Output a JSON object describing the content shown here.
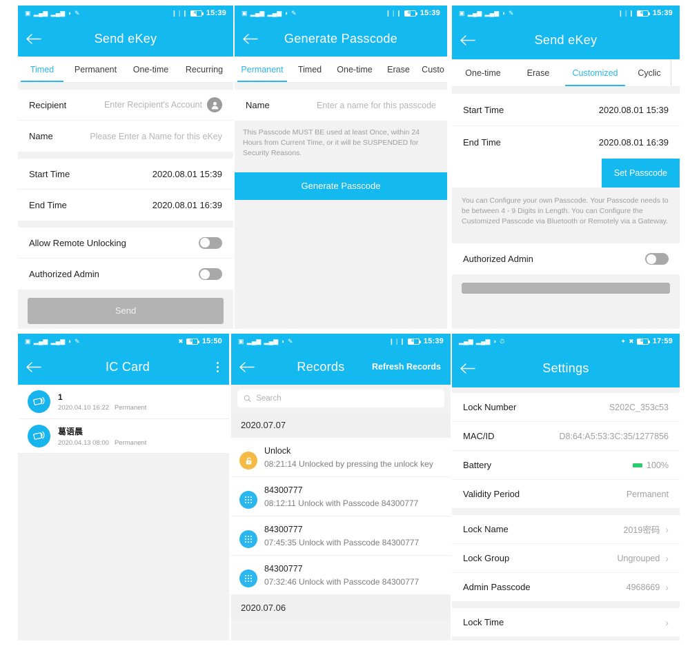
{
  "panels": {
    "send_ekey_timed": {
      "status": {
        "time": "15:39",
        "battery": "48"
      },
      "title": "Send eKey",
      "tabs": [
        {
          "label": "Timed",
          "active": true
        },
        {
          "label": "Permanent",
          "active": false
        },
        {
          "label": "One-time",
          "active": false
        },
        {
          "label": "Recurring",
          "active": false
        }
      ],
      "recipient_label": "Recipient",
      "recipient_placeholder": "Enter Recipient's Account",
      "name_label": "Name",
      "name_placeholder": "Please Enter a Name for this eKey",
      "start_label": "Start Time",
      "start_value": "2020.08.01 15:39",
      "end_label": "End Time",
      "end_value": "2020.08.01 16:39",
      "remote_label": "Allow Remote Unlocking",
      "admin_label": "Authorized Admin",
      "send_label": "Send"
    },
    "generate_passcode": {
      "status": {
        "time": "15:39",
        "battery": "48"
      },
      "title": "Generate Passcode",
      "tabs": [
        {
          "label": "Permanent",
          "active": true
        },
        {
          "label": "Timed",
          "active": false
        },
        {
          "label": "One-time",
          "active": false
        },
        {
          "label": "Erase",
          "active": false
        },
        {
          "label": "Custo",
          "active": false
        }
      ],
      "name_label": "Name",
      "name_placeholder": "Enter a name for this passcode",
      "hint": "This Passcode MUST BE used at least Once, within 24 Hours from Current Time, or it will be SUSPENDED for Security Reasons.",
      "generate_label": "Generate Passcode"
    },
    "send_ekey_customized": {
      "status": {
        "time": "15:39",
        "battery": "48"
      },
      "title": "Send eKey",
      "tabs": [
        {
          "label": "One-time",
          "active": false
        },
        {
          "label": "Erase",
          "active": false
        },
        {
          "label": "Customized",
          "active": true
        },
        {
          "label": "Cyclic",
          "active": false
        }
      ],
      "start_label": "Start Time",
      "start_value": "2020.08.01 15:39",
      "end_label": "End Time",
      "end_value": "2020.08.01 16:39",
      "set_passcode_label": "Set Passcode",
      "hint": "You can Configure your own Passcode. Your Passcode needs to be between 4 - 9 Digits in Length. You can Configure the Customized Passcode via Bluetooth or Remotely via a Gateway.",
      "admin_label": "Authorized Admin"
    },
    "ic_card": {
      "status": {
        "time": "15:50",
        "battery": "46"
      },
      "title": "IC Card",
      "items": [
        {
          "name": "1",
          "date": "2020.04.10 16:22",
          "validity": "Permanent"
        },
        {
          "name": "葛语晨",
          "date": "2020.04.13 08:00",
          "validity": "Permanent"
        }
      ]
    },
    "records": {
      "status": {
        "time": "15:39",
        "battery": "48"
      },
      "title": "Records",
      "refresh_label": "Refresh Records",
      "search_placeholder": "Search",
      "groups": [
        {
          "date": "2020.07.07",
          "items": [
            {
              "type": "unlock",
              "title": "Unlock",
              "desc": "08:21:14 Unlocked by pressing the unlock key"
            },
            {
              "type": "code",
              "title": "84300777",
              "desc": "08:12:11 Unlock with Passcode 84300777"
            },
            {
              "type": "code",
              "title": "84300777",
              "desc": "07:45:35 Unlock with Passcode 84300777"
            },
            {
              "type": "code",
              "title": "84300777",
              "desc": "07:32:46 Unlock with Passcode 84300777"
            }
          ]
        },
        {
          "date": "2020.07.06",
          "items": []
        }
      ]
    },
    "settings": {
      "status": {
        "time": "17:59",
        "battery": "40"
      },
      "title": "Settings",
      "rows": [
        {
          "label": "Lock Number",
          "value": "S202C_353c53",
          "chevron": false
        },
        {
          "label": "MAC/ID",
          "value": "D8:64:A5:53:3C:35/1277856",
          "chevron": false
        },
        {
          "label": "Battery",
          "value": "100%",
          "chevron": false,
          "battery": true
        },
        {
          "label": "Validity Period",
          "value": "Permanent",
          "chevron": false
        },
        {
          "label": "Lock Name",
          "value": "2019密码",
          "chevron": true
        },
        {
          "label": "Lock Group",
          "value": "Ungrouped",
          "chevron": true
        },
        {
          "label": "Admin Passcode",
          "value": "4968669",
          "chevron": true
        },
        {
          "label": "Lock Time",
          "value": "",
          "chevron": true
        }
      ]
    }
  },
  "colors": {
    "brand": "#14b9f0",
    "accent_tab": "#2ab6ef",
    "page_bg": "#f2f2f2",
    "disabled": "#b3b3b3",
    "unlock_badge": "#f5b945",
    "battery_green": "#2ecc71"
  },
  "icons": {
    "back": "back-arrow-icon",
    "kebab": "more-options-icon",
    "search": "search-icon",
    "avatar": "contact-avatar-icon",
    "ic_card": "ic-card-icon",
    "lock_open": "unlock-icon",
    "keypad": "keypad-icon",
    "chevron": "chevron-right-icon"
  }
}
